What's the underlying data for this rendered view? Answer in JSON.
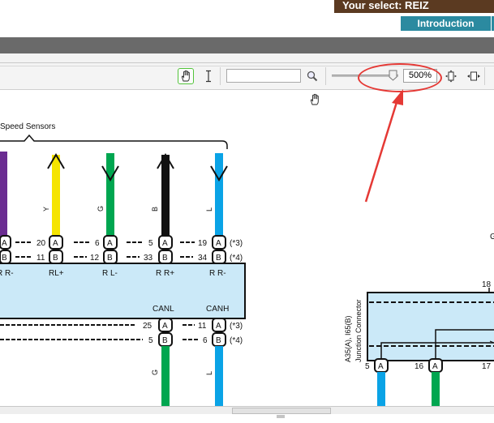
{
  "header": {
    "select_text": "Your select: REIZ",
    "intro_tab": "Introduction"
  },
  "toolbar": {
    "hand_tool": "hand-tool-icon",
    "text_tool": "text-select-icon",
    "search_value": "",
    "search_icon": "magnifier-icon",
    "zoom_value": "500%",
    "zoom_fraction": 0.95
  },
  "diagram": {
    "title": "Speed Sensors",
    "wires": [
      {
        "color_code": "Y",
        "hex": "#f5e400"
      },
      {
        "color_code": "G",
        "hex": "#00a650"
      },
      {
        "color_code": "B",
        "hex": "#111111"
      },
      {
        "color_code": "L",
        "hex": "#0aa3e6"
      }
    ],
    "pins_row_a": [
      "20",
      "6",
      "5",
      "19"
    ],
    "pins_row_b": [
      "11",
      "12",
      "33",
      "34"
    ],
    "conn_a": "A",
    "conn_b": "B",
    "note_a": "(*3)",
    "note_b": "(*4)",
    "ecu_labels": [
      "R R-",
      "RL+",
      "R L-",
      "R R+",
      "R R-"
    ],
    "can_labels": [
      "CANL",
      "CANH"
    ],
    "can_pins_a": [
      "25",
      "11"
    ],
    "can_pins_b": [
      "5",
      "6"
    ],
    "can_wire_codes": [
      "G",
      "L"
    ],
    "junction_label": "A35(A), I65(B)",
    "junction_sub": "Junction Connector",
    "junction_pins": [
      "5",
      "16",
      "17",
      "18"
    ]
  }
}
